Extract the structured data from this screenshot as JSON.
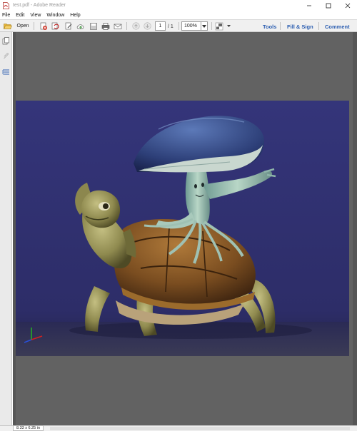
{
  "window": {
    "title": "test.pdf - Adobe Reader"
  },
  "menu": {
    "items": [
      "File",
      "Edit",
      "View",
      "Window",
      "Help"
    ]
  },
  "toolbar": {
    "open_label": "Open",
    "page_current": "1",
    "page_total": "/ 1",
    "zoom": "100%",
    "tools_label": "Tools",
    "fillsign_label": "Fill & Sign",
    "comment_label": "Comment"
  },
  "status": {
    "page_size": "8.33 x 6.25 in"
  },
  "icons": {
    "app": "pdf-file-icon",
    "open": "folder-open-icon",
    "create": "create-pdf-icon",
    "upload": "cloud-upload-icon",
    "save": "save-icon",
    "print": "print-icon",
    "email": "email-icon",
    "prev": "arrow-up-icon",
    "next": "arrow-down-icon",
    "thumbnails": "page-thumbnails-icon",
    "attachments": "paperclip-icon",
    "layers": "layers-icon"
  },
  "colors": {
    "accent": "#2d5fb1",
    "scene_bg": "#2f2f6e",
    "doc_bg": "#565656"
  }
}
